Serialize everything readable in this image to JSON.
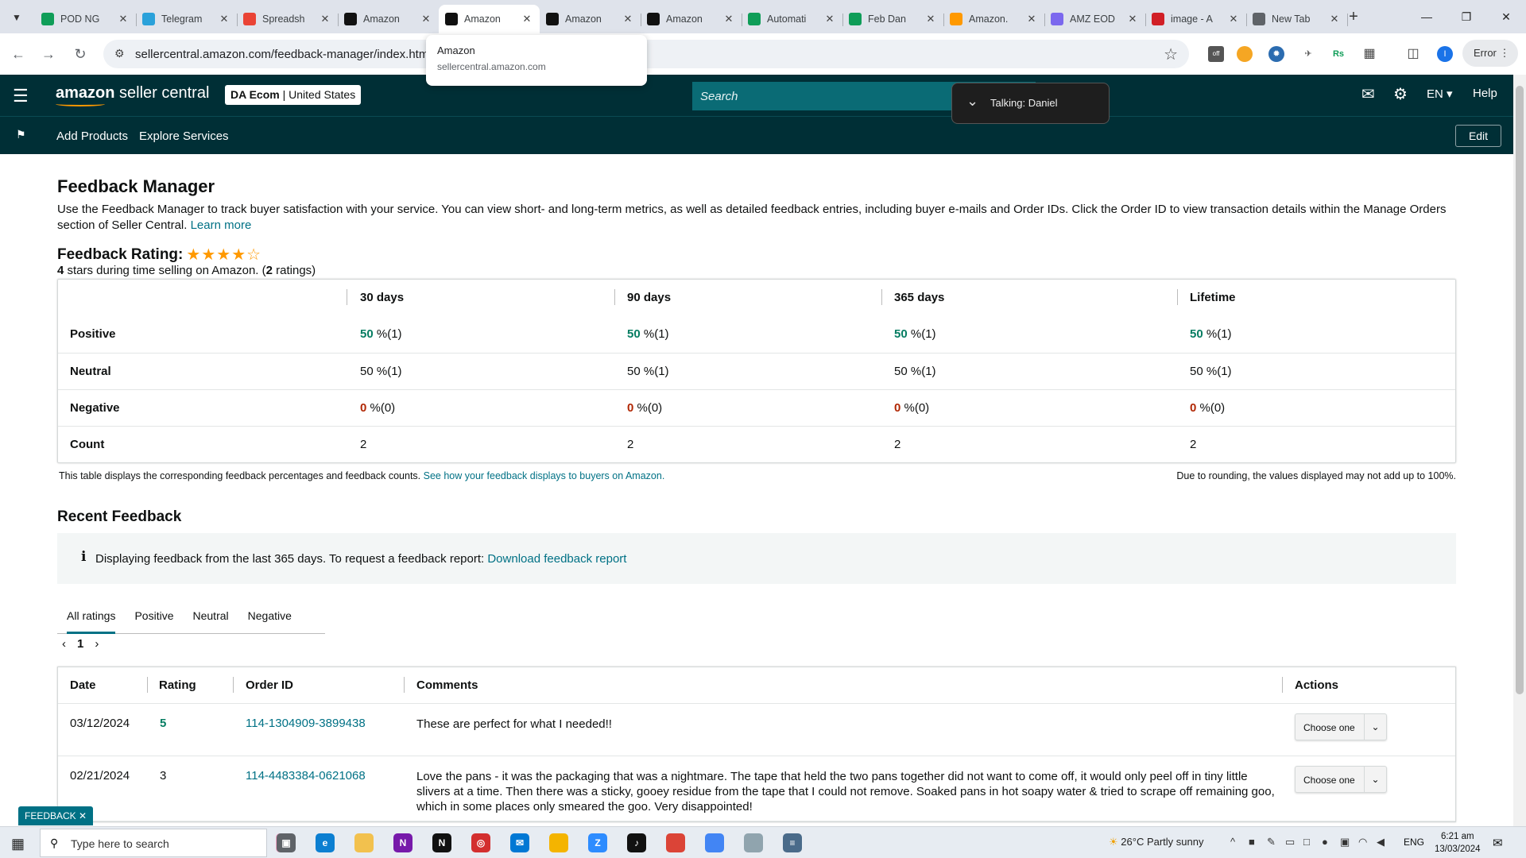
{
  "browser": {
    "tabs": [
      {
        "title": "POD NG",
        "icon": "sheets-icon",
        "color": "#0f9d58"
      },
      {
        "title": "Telegram",
        "icon": "telegram-icon",
        "color": "#2aa1da"
      },
      {
        "title": "Spreadsh",
        "icon": "gmail-icon",
        "color": "#ea4335"
      },
      {
        "title": "Amazon",
        "icon": "amazon-icon",
        "color": "#111111"
      },
      {
        "title": "Amazon",
        "icon": "amazon-icon",
        "color": "#111111"
      },
      {
        "title": "Amazon",
        "icon": "amazon-icon",
        "color": "#111111"
      },
      {
        "title": "Amazon",
        "icon": "amazon-icon",
        "color": "#111111"
      },
      {
        "title": "Automati",
        "icon": "sheets-icon",
        "color": "#0f9d58"
      },
      {
        "title": "Feb Dan",
        "icon": "sheets-icon",
        "color": "#0f9d58"
      },
      {
        "title": "Amazon.",
        "icon": "amazon-smile-icon",
        "color": "#ff9900"
      },
      {
        "title": "AMZ EOD",
        "icon": "clickup-icon",
        "color": "#7b68ee"
      },
      {
        "title": "image - A",
        "icon": "vivaldi-icon",
        "color": "#d11f26"
      },
      {
        "title": "New Tab",
        "icon": "chrome-icon",
        "color": "#5f6368"
      }
    ],
    "active_tab_index": 4,
    "url": "sellercentral.amazon.com/feedback-manager/index.htm",
    "hovercard": {
      "title": "Amazon",
      "subtitle": "sellercentral.amazon.com"
    },
    "error_label": "Error",
    "profile_initial": "I"
  },
  "header": {
    "logo_bold": "amazon",
    "logo_rest": " seller central",
    "account_name": "DA Ecom",
    "account_region": "United States",
    "search_placeholder": "Search",
    "talking": "Talking: Daniel",
    "language": "EN",
    "help": "Help",
    "nav": [
      "Add Products",
      "Explore Services"
    ],
    "edit": "Edit"
  },
  "page": {
    "title": "Feedback Manager",
    "intro": "Use the Feedback Manager to track buyer satisfaction with your service. You can view short- and long-term metrics, as well as detailed feedback entries, including buyer e-mails and Order IDs. Click the Order ID to view transaction details within the Manage Orders section of Seller Central.",
    "learn_more": "Learn more",
    "rating_label": "Feedback Rating:",
    "rating_stars": 4,
    "rating_max": 5,
    "rating_sub_stars": "4",
    "rating_sub_mid": " stars during time selling on Amazon. (",
    "rating_sub_count": "2",
    "rating_sub_end": " ratings)"
  },
  "metrics": {
    "columns": [
      "30 days",
      "90 days",
      "365 days",
      "Lifetime"
    ],
    "rows": [
      {
        "label": "Positive",
        "cells": [
          [
            "50",
            " %(1)"
          ],
          [
            "50",
            " %(1)"
          ],
          [
            "50",
            " %(1)"
          ],
          [
            "50",
            " %(1)"
          ]
        ],
        "tone": "green"
      },
      {
        "label": "Neutral",
        "cells": [
          [
            "50",
            " %(1)"
          ],
          [
            "50",
            " %(1)"
          ],
          [
            "50",
            " %(1)"
          ],
          [
            "50",
            " %(1)"
          ]
        ],
        "tone": "plain"
      },
      {
        "label": "Negative",
        "cells": [
          [
            "0",
            " %(0)"
          ],
          [
            "0",
            " %(0)"
          ],
          [
            "0",
            " %(0)"
          ],
          [
            "0",
            " %(0)"
          ]
        ],
        "tone": "red"
      },
      {
        "label": "Count",
        "cells": [
          [
            "2",
            ""
          ],
          [
            "2",
            ""
          ],
          [
            "2",
            ""
          ],
          [
            "2",
            ""
          ]
        ],
        "tone": "plain"
      }
    ],
    "note": "This table displays the corresponding feedback percentages and feedback counts.",
    "note_link": "See how your feedback displays to buyers on Amazon.",
    "rounding": "Due to rounding, the values displayed may not add up to 100%."
  },
  "recent": {
    "title": "Recent Feedback",
    "info": "Displaying feedback from the last 365 days. To request a feedback report:",
    "info_link": "Download feedback report",
    "filters": [
      "All ratings",
      "Positive",
      "Neutral",
      "Negative"
    ],
    "active_filter": 0,
    "page": "1",
    "columns": [
      "Date",
      "Rating",
      "Order ID",
      "Comments",
      "Actions"
    ],
    "rows": [
      {
        "date": "03/12/2024",
        "rating": "5",
        "order_id": "114-1304909-3899438",
        "comment": "These are perfect for what I needed!!",
        "action": "Choose one"
      },
      {
        "date": "02/21/2024",
        "rating": "3",
        "order_id": "114-4483384-0621068",
        "comment": "Love the pans - it was the packaging that was a nightmare. The tape that held the two pans together did not want to come off, it would only peel off in tiny little slivers at a time. Then there was a sticky, gooey residue from the tape that I could not remove. Soaked pans in hot soapy water & tried to scrape off remaining goo, which in some places only smeared the goo. Very disappointed!",
        "action": "Choose one"
      }
    ]
  },
  "feedback_tab": "FEEDBACK",
  "taskbar": {
    "search_placeholder": "Type here to search",
    "weather": "26°C  Partly sunny",
    "lang": "ENG",
    "time": "6:21 am",
    "date": "13/03/2024"
  }
}
